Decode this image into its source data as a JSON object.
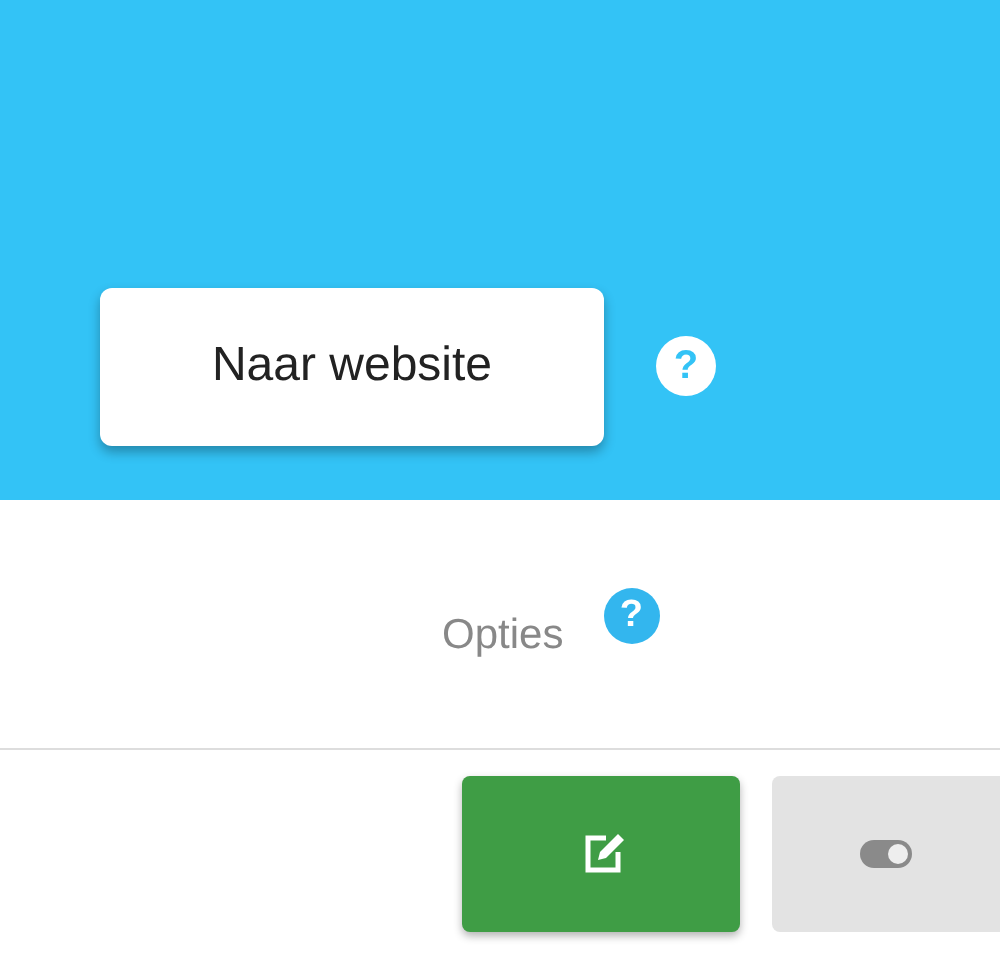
{
  "banner": {
    "button": "Naar website",
    "help": "?"
  },
  "options": {
    "label": "Opties",
    "help": "?"
  },
  "actions": [
    {
      "kind": "edit"
    },
    {
      "kind": "toggle"
    }
  ]
}
